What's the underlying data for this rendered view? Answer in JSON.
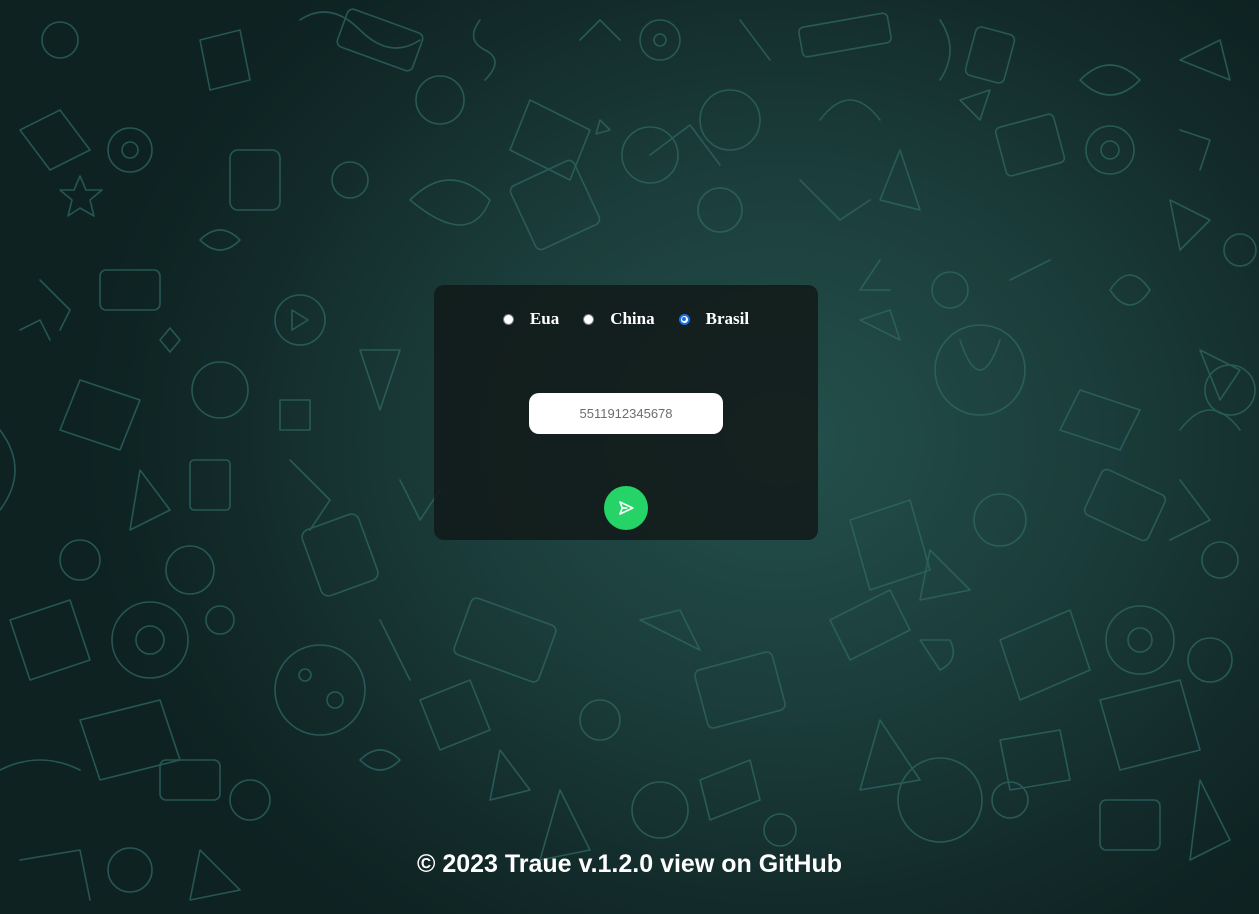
{
  "country_selector": {
    "options": [
      {
        "label": "Eua",
        "checked": false
      },
      {
        "label": "China",
        "checked": false
      },
      {
        "label": "Brasil",
        "checked": true
      }
    ]
  },
  "phone": {
    "placeholder": "5511912345678",
    "value": ""
  },
  "send_button": {
    "icon": "send-icon",
    "color": "#25d366"
  },
  "footer": {
    "copyright": "© 2023 Traue v.1.2.0",
    "link_label": "view on GitHub"
  },
  "colors": {
    "accent": "#25d366",
    "radio_selected": "#1e6fe0"
  }
}
